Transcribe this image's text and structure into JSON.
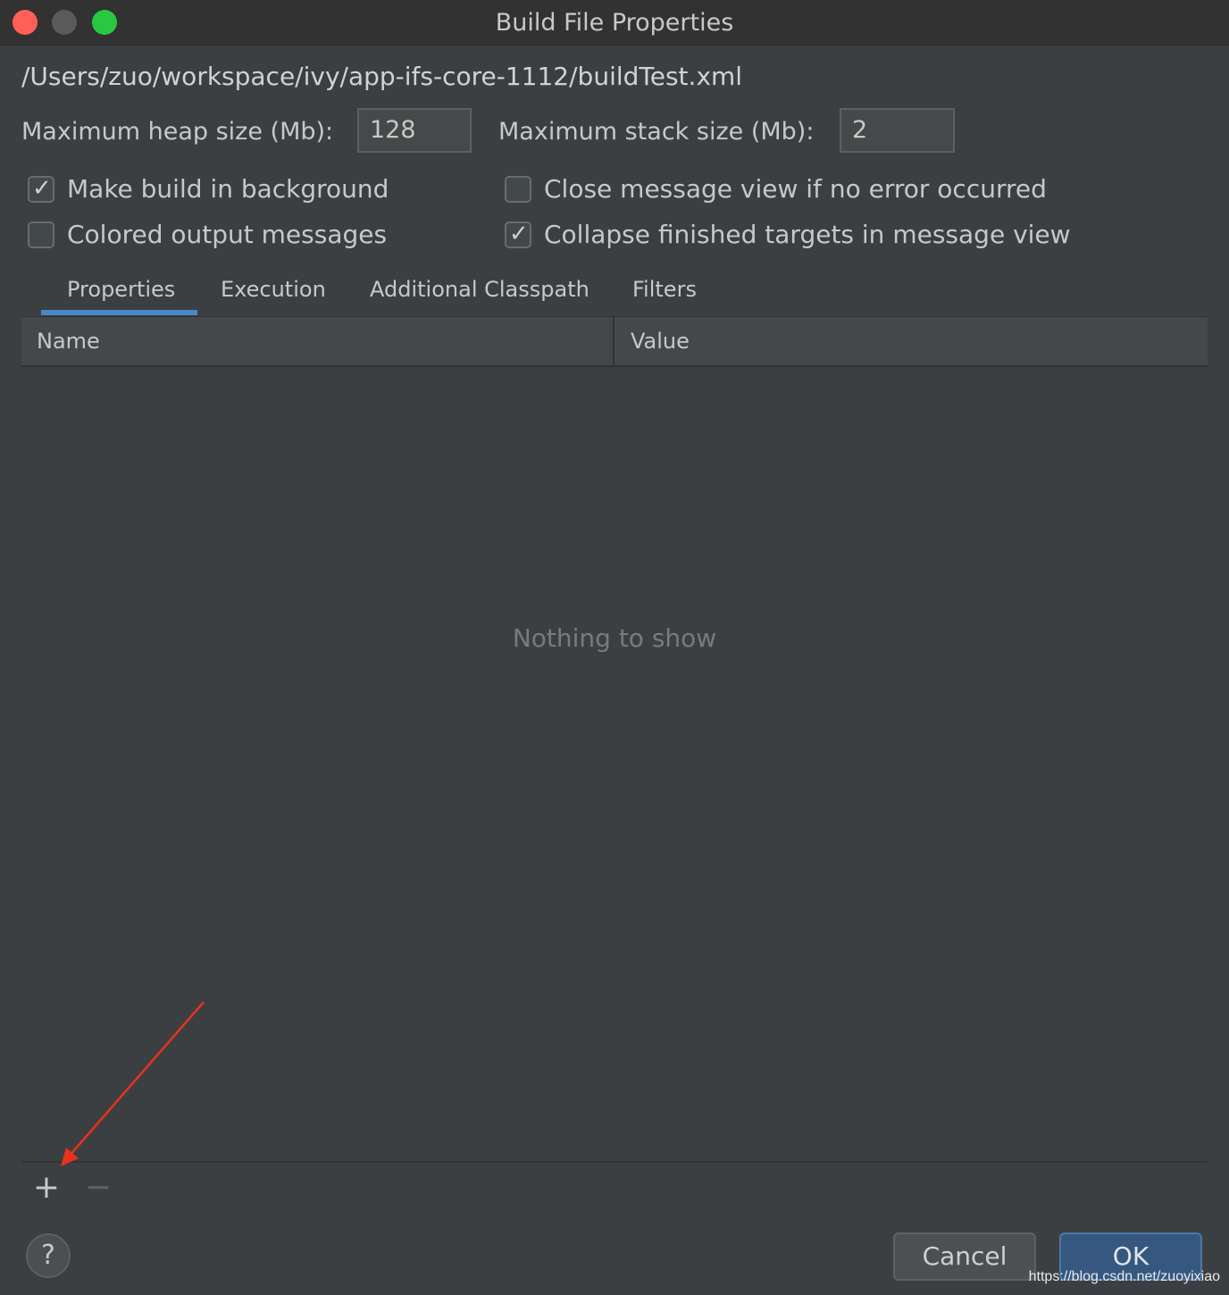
{
  "window": {
    "title": "Build File Properties"
  },
  "file_path": "/Users/zuo/workspace/ivy/app-ifs-core-1112/buildTest.xml",
  "heap": {
    "label": "Maximum heap size (Mb):",
    "value": "128"
  },
  "stack": {
    "label": "Maximum stack size (Mb):",
    "value": "2"
  },
  "options": {
    "make_build_background": {
      "label": "Make build in background",
      "checked": true
    },
    "close_message_view": {
      "label": "Close message view if no error occurred",
      "checked": false
    },
    "colored_output": {
      "label": "Colored output messages",
      "checked": false
    },
    "collapse_finished": {
      "label": "Collapse finished targets in message view",
      "checked": true
    }
  },
  "tabs": [
    {
      "label": "Properties",
      "active": true
    },
    {
      "label": "Execution",
      "active": false
    },
    {
      "label": "Additional Classpath",
      "active": false
    },
    {
      "label": "Filters",
      "active": false
    }
  ],
  "table": {
    "columns": [
      "Name",
      "Value"
    ],
    "empty_text": "Nothing to show"
  },
  "toolbar": {
    "add_symbol": "+",
    "remove_symbol": "−"
  },
  "buttons": {
    "help": "?",
    "cancel": "Cancel",
    "ok": "OK"
  },
  "watermark": "https://blog.csdn.net/zuoyixiao",
  "colors": {
    "background": "#3c3f41",
    "accent": "#4a88c7",
    "ok_button": "#365880",
    "annotation_arrow": "#e8321e"
  },
  "icons": [
    "close-icon",
    "minimize-icon",
    "maximize-icon",
    "checkmark-icon",
    "plus-icon",
    "minus-icon",
    "help-icon",
    "arrow-annotation"
  ]
}
